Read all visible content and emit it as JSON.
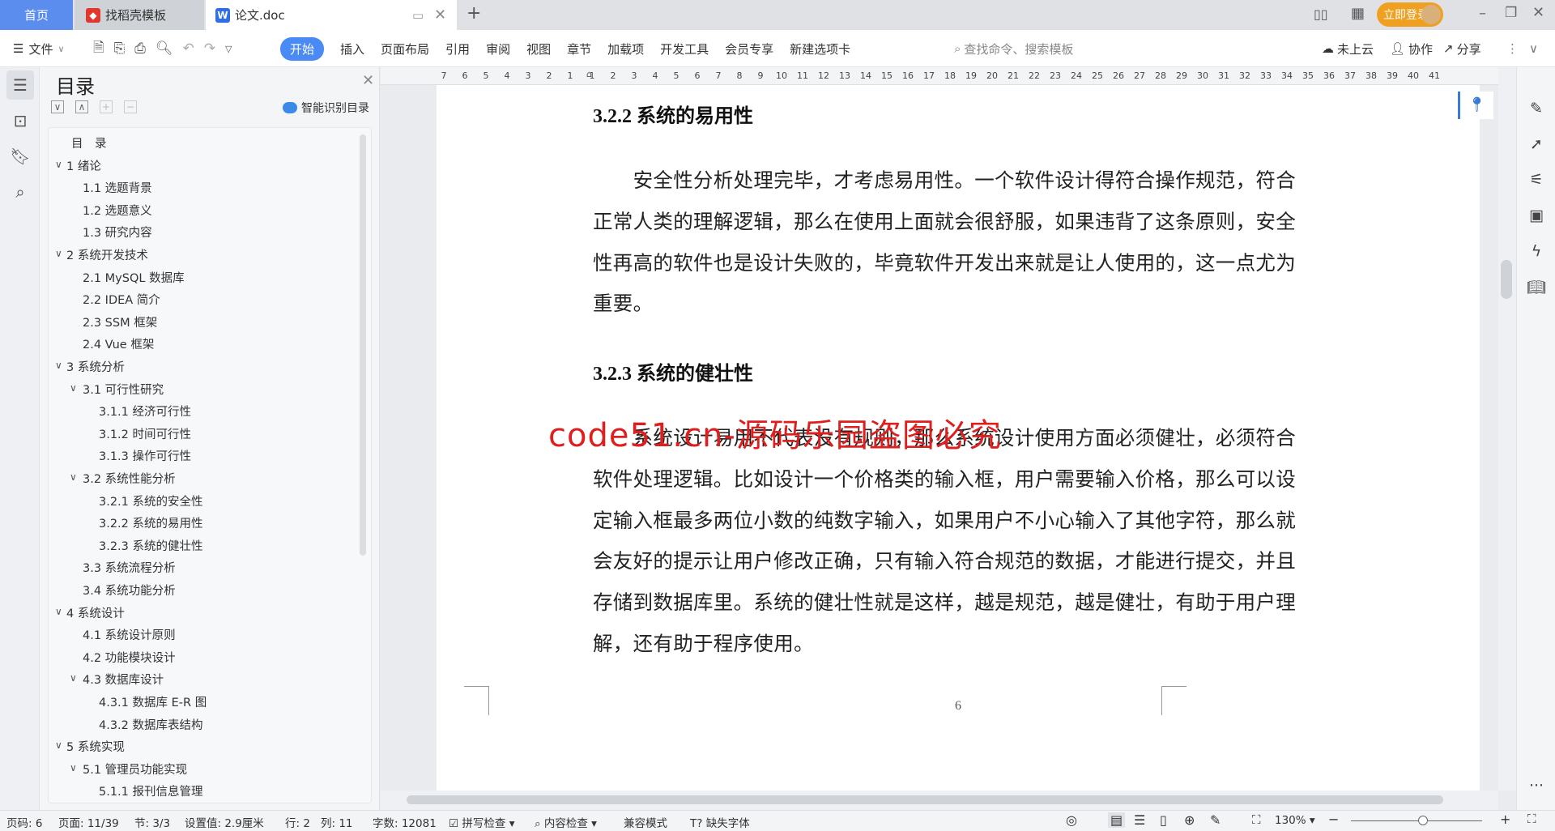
{
  "tabs": [
    {
      "label": "首页"
    },
    {
      "label": "找稻壳模板"
    },
    {
      "label": "论文.doc"
    }
  ],
  "titlebar": {
    "login_label": "立即登录"
  },
  "toolbar": {
    "file": "文件",
    "menus": [
      "开始",
      "插入",
      "页面布局",
      "引用",
      "审阅",
      "视图",
      "章节",
      "加载项",
      "开发工具",
      "会员专享",
      "新建选项卡"
    ],
    "active": "开始",
    "search_placeholder": "查找命令、搜索模板",
    "cloud": "未上云",
    "collab": "协作",
    "share": "分享"
  },
  "toc": {
    "title": "目录",
    "smart": "智能识别目录",
    "items": [
      {
        "label": "目　录",
        "level": 0
      },
      {
        "label": "1  绪论",
        "level": 1,
        "expanded": true
      },
      {
        "label": "1.1  选题背景",
        "level": 2
      },
      {
        "label": "1.2  选题意义",
        "level": 2
      },
      {
        "label": "1.3  研究内容",
        "level": 2
      },
      {
        "label": "2  系统开发技术",
        "level": 1,
        "expanded": true
      },
      {
        "label": "2.1  MySQL 数据库",
        "level": 2
      },
      {
        "label": "2.2  IDEA 简介",
        "level": 2
      },
      {
        "label": "2.3  SSM 框架",
        "level": 2
      },
      {
        "label": "2.4  Vue 框架",
        "level": 2
      },
      {
        "label": "3  系统分析",
        "level": 1,
        "expanded": true
      },
      {
        "label": "3.1  可行性研究",
        "level": 2,
        "expanded": true
      },
      {
        "label": "3.1.1  经济可行性",
        "level": 3
      },
      {
        "label": "3.1.2  时间可行性",
        "level": 3
      },
      {
        "label": "3.1.3  操作可行性",
        "level": 3
      },
      {
        "label": "3.2  系统性能分析",
        "level": 2,
        "expanded": true
      },
      {
        "label": "3.2.1  系统的安全性",
        "level": 3
      },
      {
        "label": "3.2.2  系统的易用性",
        "level": 3
      },
      {
        "label": "3.2.3  系统的健壮性",
        "level": 3
      },
      {
        "label": "3.3  系统流程分析",
        "level": 2
      },
      {
        "label": "3.4  系统功能分析",
        "level": 2
      },
      {
        "label": "4  系统设计",
        "level": 1,
        "expanded": true
      },
      {
        "label": "4.1  系统设计原则",
        "level": 2
      },
      {
        "label": "4.2  功能模块设计",
        "level": 2
      },
      {
        "label": "4.3  数据库设计",
        "level": 2,
        "expanded": true
      },
      {
        "label": "4.3.1  数据库 E-R 图",
        "level": 3
      },
      {
        "label": "4.3.2  数据库表结构",
        "level": 3
      },
      {
        "label": "5  系统实现",
        "level": 1,
        "expanded": true
      },
      {
        "label": "5.1  管理员功能实现",
        "level": 2,
        "expanded": true
      },
      {
        "label": "5.1.1  报刊信息管理",
        "level": 3
      }
    ]
  },
  "ruler": {
    "left": [
      "7",
      "6",
      "5",
      "4",
      "3",
      "2",
      "1"
    ],
    "right_max": 41
  },
  "document": {
    "heading1": "3.2.2  系统的易用性",
    "para1": [
      "　　安全性分析处理完毕，才考虑易用性。一个软件设计得符合操作规范，符合",
      "正常人类的理解逻辑，那么在使用上面就会很舒服，如果违背了这条原则，安全",
      "性再高的软件也是设计失败的，毕竟软件开发出来就是让人使用的，这一点尤为",
      "重要。"
    ],
    "heading2": "3.2.3  系统的健壮性",
    "para2": [
      "　　系统设计易用不代表没有规则，那么系统设计使用方面必须健壮，必须符合",
      "软件处理逻辑。比如设计一个价格类的输入框，用户需要输入价格，那么可以设",
      "定输入框最多两位小数的纯数字输入，如果用户不小心输入了其他字符，那么就",
      "会友好的提示让用户修改正确，只有输入符合规范的数据，才能进行提交，并且",
      "存储到数据库里。系统的健壮性就是这样，越是规范，越是健壮，有助于用户理",
      "解，还有助于程序使用。"
    ],
    "page_number": "6",
    "watermark": "code51.cn-源码乐园盗图必究"
  },
  "status": {
    "page": "页码: 6",
    "pages": "页面: 11/39",
    "section": "节: 3/3",
    "setting": "设置值: 2.9厘米",
    "row": "行: 2",
    "col": "列: 11",
    "words": "字数: 12081",
    "spell": "拼写检查",
    "content": "内容检查",
    "compat": "兼容模式",
    "font": "缺失字体",
    "zoom": "130%",
    "zoom_level": 0.55
  },
  "colors": {
    "accent": "#4a8af4",
    "watermark": "#e01e1e",
    "login": "#f0a020"
  }
}
